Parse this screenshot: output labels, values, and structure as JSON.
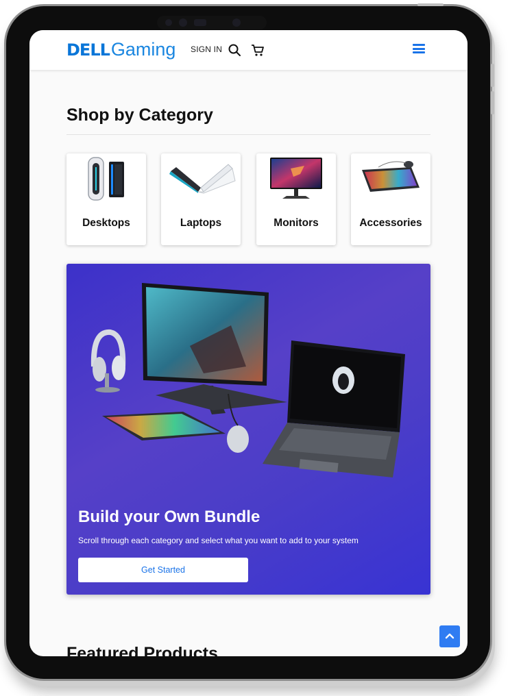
{
  "brand": {
    "logo_word": "DELL",
    "logo_sub": "Gaming",
    "color": "#1a73e8"
  },
  "header": {
    "signin_label": "SIGN IN",
    "icons": [
      "search-icon",
      "cart-icon",
      "menu-icon"
    ]
  },
  "categories": {
    "title": "Shop by Category",
    "items": [
      {
        "label": "Desktops",
        "icon": "desktop-tower-image"
      },
      {
        "label": "Laptops",
        "icon": "laptop-image"
      },
      {
        "label": "Monitors",
        "icon": "monitor-image"
      },
      {
        "label": "Accessories",
        "icon": "keyboard-mouse-image"
      }
    ]
  },
  "hero": {
    "title": "Build your Own Bundle",
    "subtitle": "Scroll through each category and select what you want to add to your system",
    "button_label": "Get Started",
    "gradient": [
      "#3c31c9",
      "#5640c8",
      "#3833d3"
    ]
  },
  "featured": {
    "title": "Featured Products"
  },
  "scroll_top": {
    "icon": "chevron-up-icon",
    "color": "#2f7cf2"
  }
}
